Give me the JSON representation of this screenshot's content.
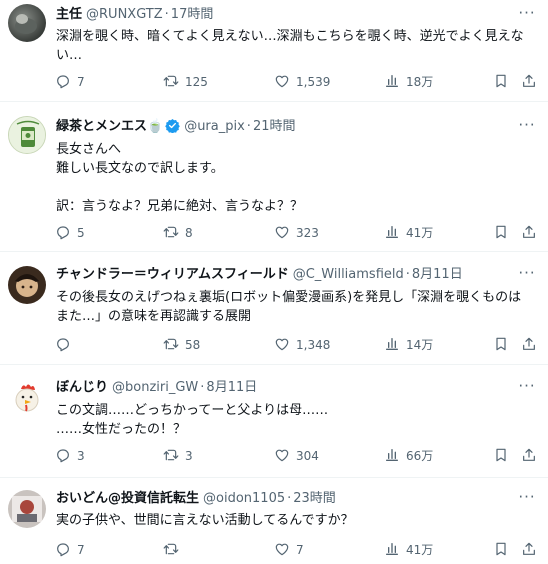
{
  "tweets": [
    {
      "name": "主任",
      "handle": "@RUNXGTZ",
      "dot": "·",
      "time": "17時間",
      "verified": false,
      "text": "深淵を覗く時、暗くてよく見えない…深淵もこちらを覗く時、逆光でよく見えない…",
      "replies": "7",
      "retweets": "125",
      "likes": "1,539",
      "views": "18万",
      "more_label": "···"
    },
    {
      "name": "緑茶とメンエス🍵",
      "handle": "@ura_pix",
      "dot": "·",
      "time": "21時間",
      "verified": true,
      "text": "長女さんへ\n難しい長文なので訳します。\n\n訳：言うなよ？兄弟に絶対、言うなよ？？",
      "replies": "5",
      "retweets": "8",
      "likes": "323",
      "views": "41万",
      "more_label": "···"
    },
    {
      "name": "チャンドラー＝ウィリアムスフィールド",
      "handle": "@C_Williamsfield",
      "dot": "·",
      "time": "8月11日",
      "verified": false,
      "text": "その後長女のえげつねぇ裏垢(ロボット偏愛漫画系)を発見し「深淵を覗くものはまた…」の意味を再認識する展開",
      "replies": "",
      "retweets": "58",
      "likes": "1,348",
      "views": "14万",
      "more_label": "···"
    },
    {
      "name": "ぼんじり",
      "handle": "@bonziri_GW",
      "dot": "·",
      "time": "8月11日",
      "verified": false,
      "text": "この文調……どっちかってーと父よりは母……\n……女性だったの！？",
      "replies": "3",
      "retweets": "3",
      "likes": "304",
      "views": "66万",
      "more_label": "···"
    },
    {
      "name": "おいどん@投資信託転生",
      "handle": "@oidon1105",
      "dot": "·",
      "time": "23時間",
      "verified": false,
      "text": "実の子供や、世間に言えない活動してるんですか？",
      "replies": "7",
      "retweets": "",
      "likes": "7",
      "views": "41万",
      "more_label": "···"
    }
  ],
  "colors": {
    "text": "#0f1419",
    "secondary": "#536471",
    "divider": "#eff3f4",
    "verified": "#1d9bf0"
  },
  "icons": [
    "reply-icon",
    "retweet-icon",
    "like-icon",
    "views-icon",
    "bookmark-icon",
    "share-icon",
    "more-icon",
    "verified-badge-icon"
  ]
}
